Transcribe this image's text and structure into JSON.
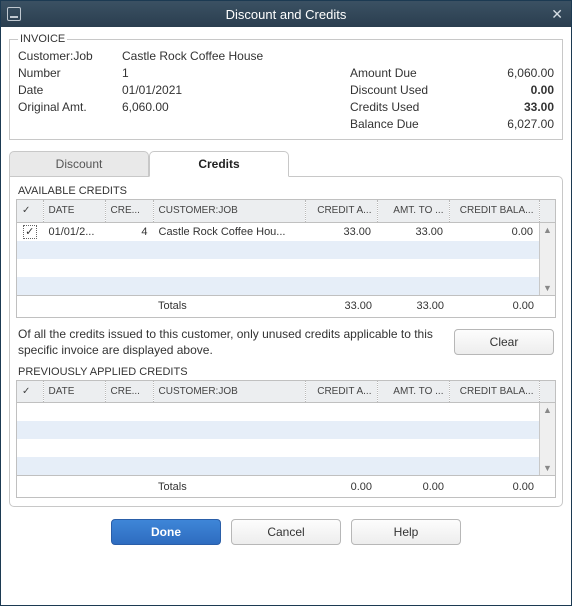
{
  "window": {
    "title": "Discount and Credits"
  },
  "invoice": {
    "legend": "INVOICE",
    "labels": {
      "customerJob": "Customer:Job",
      "number": "Number",
      "date": "Date",
      "originalAmt": "Original Amt.",
      "amountDue": "Amount Due",
      "discountUsed": "Discount Used",
      "creditsUsed": "Credits Used",
      "balanceDue": "Balance Due"
    },
    "customerJob": "Castle Rock Coffee House",
    "number": "1",
    "date": "01/01/2021",
    "originalAmt": "6,060.00",
    "amountDue": "6,060.00",
    "discountUsed": "0.00",
    "creditsUsed": "33.00",
    "balanceDue": "6,027.00"
  },
  "tabs": {
    "discount": "Discount",
    "credits": "Credits"
  },
  "columns": {
    "check": "✓",
    "date": "DATE",
    "creditNo": "CRE...",
    "customerJob": "CUSTOMER:JOB",
    "creditAmt": "CREDIT A...",
    "amtToUse": "AMT. TO ...",
    "creditBal": "CREDIT BALA..."
  },
  "available": {
    "title": "AVAILABLE CREDITS",
    "rows": [
      {
        "checked": true,
        "date": "01/01/2...",
        "creditNo": "4",
        "customerJob": "Castle Rock Coffee Hou...",
        "creditAmt": "33.00",
        "amtToUse": "33.00",
        "creditBal": "0.00"
      }
    ],
    "totalsLabel": "Totals",
    "totals": {
      "creditAmt": "33.00",
      "amtToUse": "33.00",
      "creditBal": "0.00"
    }
  },
  "note": "Of all the credits issued to this customer, only unused credits applicable to this specific invoice are displayed above.",
  "buttons": {
    "clear": "Clear",
    "done": "Done",
    "cancel": "Cancel",
    "help": "Help"
  },
  "previous": {
    "title": "PREVIOUSLY APPLIED CREDITS",
    "totalsLabel": "Totals",
    "totals": {
      "creditAmt": "0.00",
      "amtToUse": "0.00",
      "creditBal": "0.00"
    }
  }
}
